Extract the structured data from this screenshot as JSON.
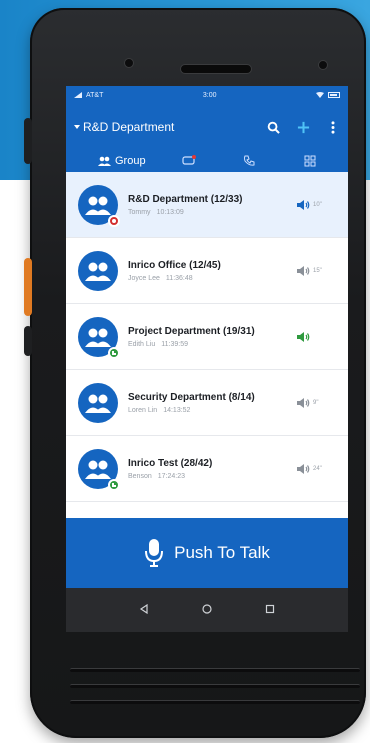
{
  "status_bar": {
    "carrier": "AT&T",
    "time": "3:00"
  },
  "app_bar": {
    "title": "R&D Department",
    "icons": [
      "dropdown-arrow-icon",
      "search-icon",
      "add-icon",
      "more-vert-icon"
    ]
  },
  "tabs": [
    {
      "label": "Group",
      "icon": "group-icon"
    },
    {
      "label": "",
      "icon": "chat-icon"
    },
    {
      "label": "",
      "icon": "phone-icon"
    },
    {
      "label": "",
      "icon": "grid-icon"
    }
  ],
  "groups": [
    {
      "name": "R&D Department (12/33)",
      "user": "Tommy",
      "time": "10:13:09",
      "duration": "10\"",
      "badge": "red",
      "speaker_color": "#1565c0",
      "selected": true
    },
    {
      "name": "Inrico Office (12/45)",
      "user": "Joyce Lee",
      "time": "11:36:48",
      "duration": "15\"",
      "badge": "none",
      "speaker_color": "#8a9098",
      "selected": false
    },
    {
      "name": "Project Department (19/31)",
      "user": "Edith Liu",
      "time": "11:39:59",
      "duration": "",
      "badge": "green",
      "speaker_color": "#2e9a3e",
      "selected": false
    },
    {
      "name": "Security Department (8/14)",
      "user": "Loren Lin",
      "time": "14:13:52",
      "duration": "9\"",
      "badge": "none",
      "speaker_color": "#8a9098",
      "selected": false
    },
    {
      "name": "Inrico Test (28/42)",
      "user": "Benson",
      "time": "17:24:23",
      "duration": "24\"",
      "badge": "green",
      "speaker_color": "#8a9098",
      "selected": false
    }
  ],
  "ptt": {
    "label": "Push To Talk",
    "icon": "microphone-icon"
  },
  "nav": [
    "back-icon",
    "home-icon",
    "recent-apps-icon"
  ],
  "colors": {
    "primary": "#1565c0",
    "accent_orange": "#e07a22",
    "background_band": "#1a84c8"
  }
}
